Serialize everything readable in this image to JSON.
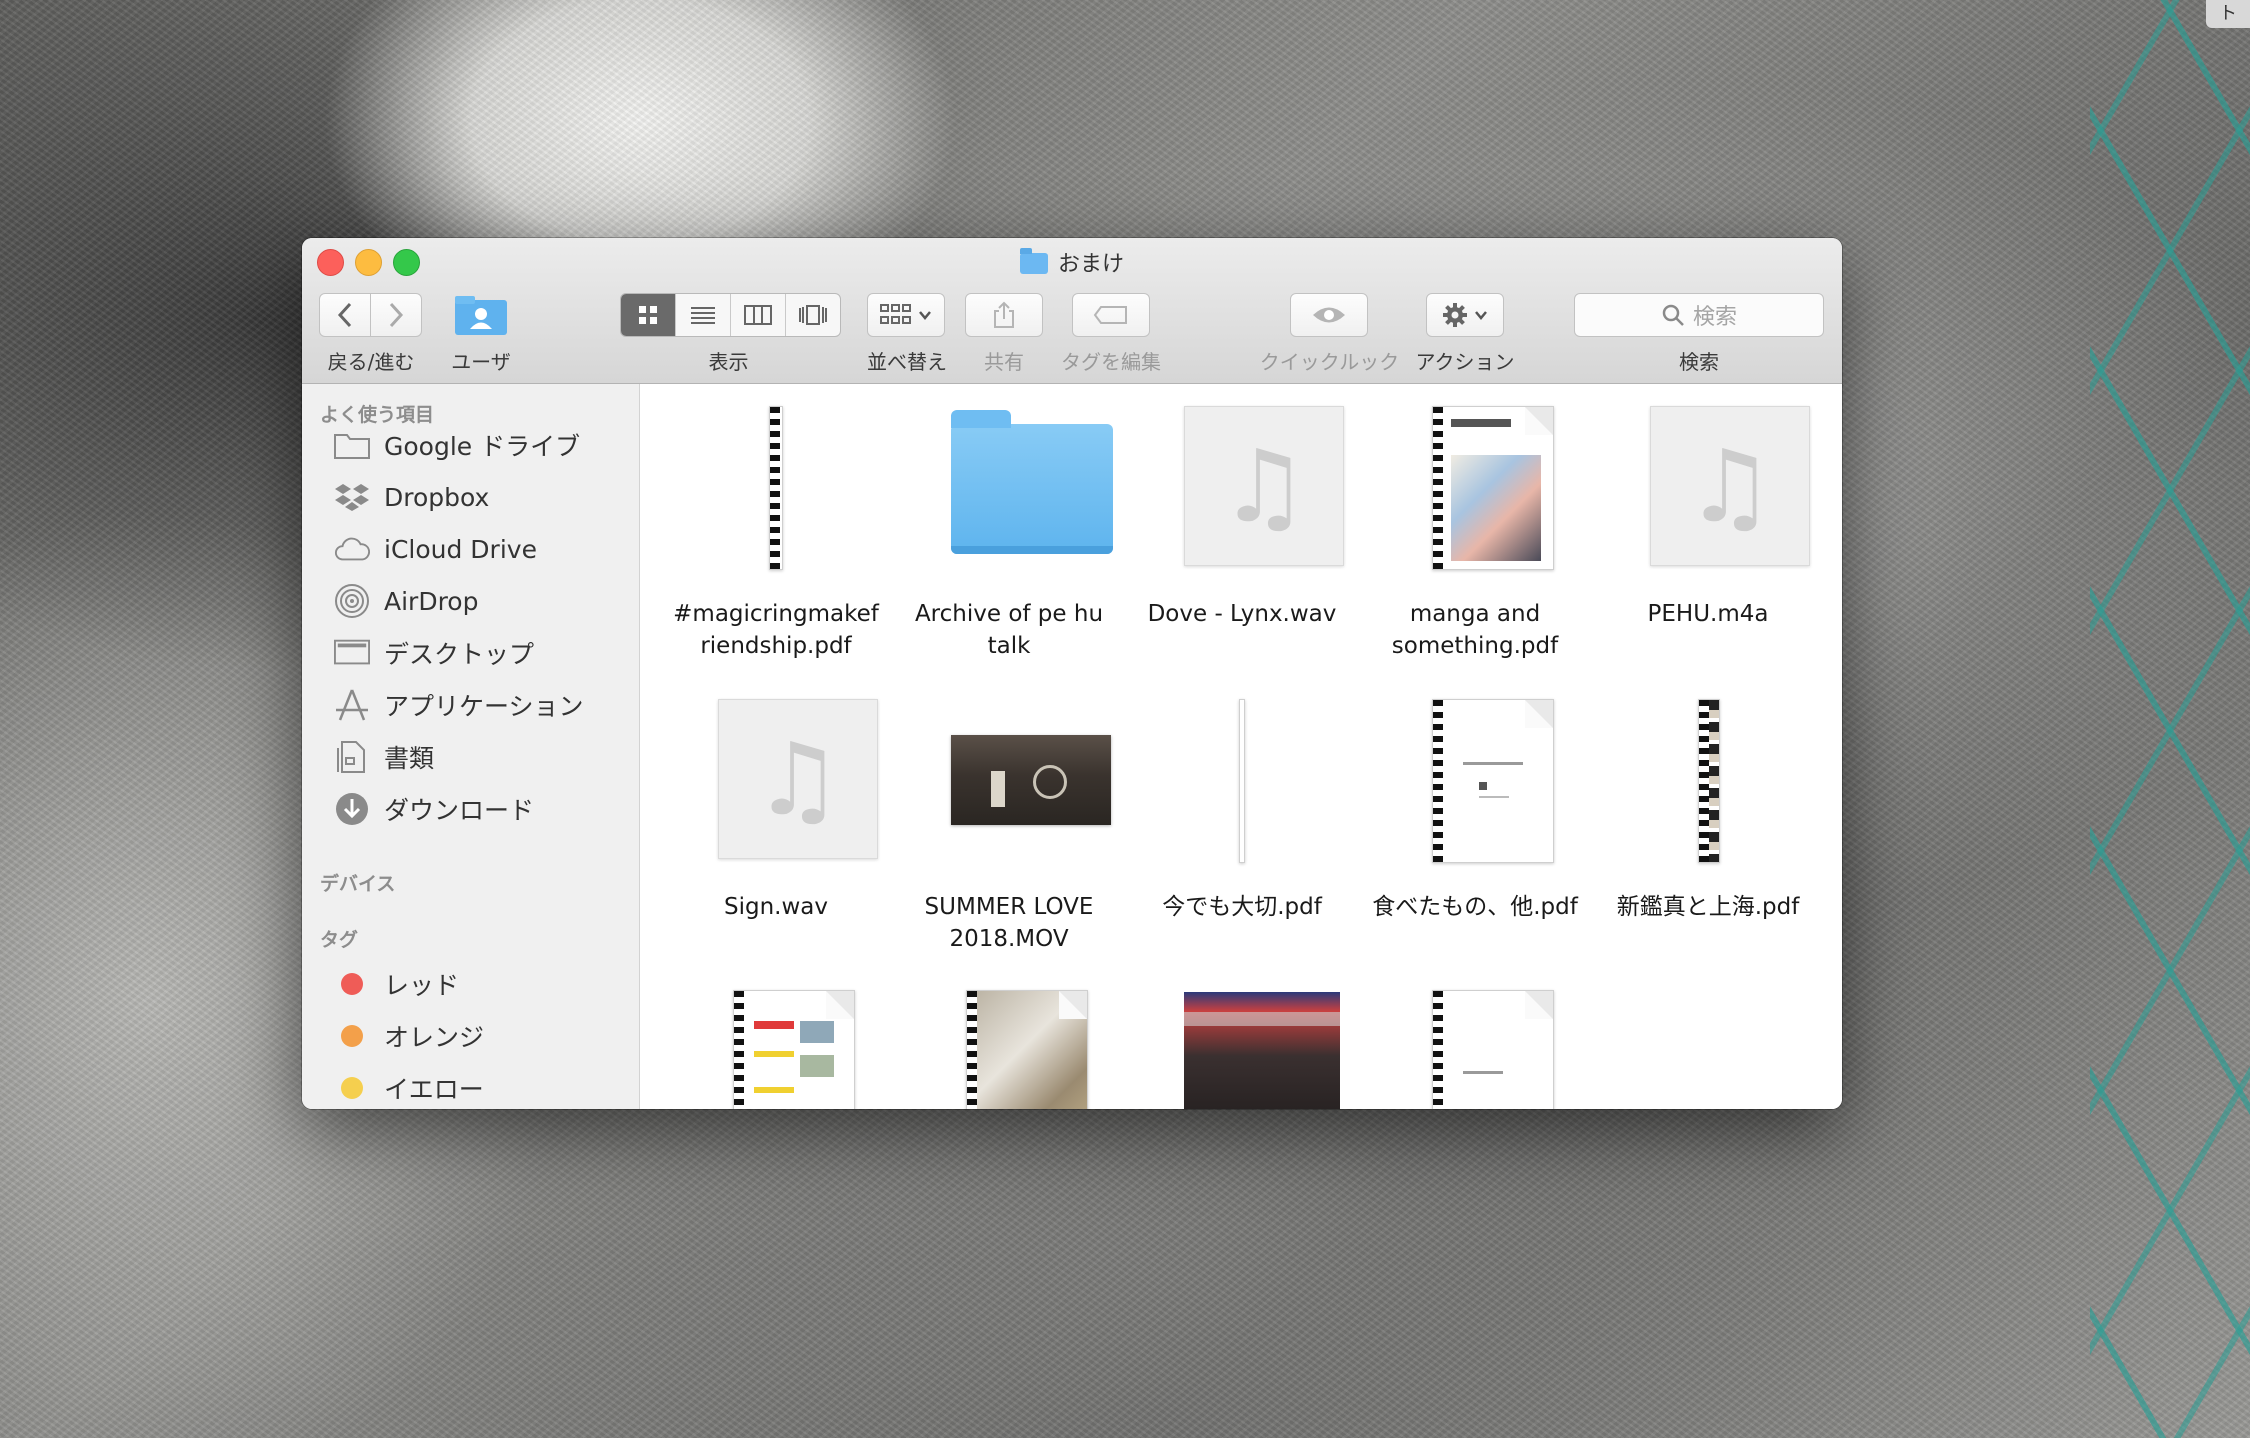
{
  "window": {
    "title": "おまけ"
  },
  "corner": {
    "text": "ト"
  },
  "toolbar": {
    "nav": {
      "back_icon": "chevron-left",
      "forward_icon": "chevron-right",
      "label": "戻る/進む"
    },
    "user": {
      "label": "ユーザ"
    },
    "view": {
      "label": "表示",
      "modes": [
        "icon",
        "list",
        "column",
        "cover-flow"
      ],
      "active": "icon"
    },
    "arrange": {
      "label": "並べ替え"
    },
    "share": {
      "label": "共有"
    },
    "tags": {
      "label": "タグを編集"
    },
    "quicklook": {
      "label": "クイックルック"
    },
    "action": {
      "label": "アクション"
    },
    "search": {
      "placeholder": "検索",
      "label": "検索"
    }
  },
  "sidebar": {
    "favorites_header": "よく使う項目",
    "favorites": [
      {
        "label": "Google ドライブ",
        "icon": "folder-icon"
      },
      {
        "label": "Dropbox",
        "icon": "dropbox-icon"
      },
      {
        "label": "iCloud Drive",
        "icon": "cloud-icon"
      },
      {
        "label": "AirDrop",
        "icon": "airdrop-icon"
      },
      {
        "label": "デスクトップ",
        "icon": "desktop-icon"
      },
      {
        "label": "アプリケーション",
        "icon": "applications-icon"
      },
      {
        "label": "書類",
        "icon": "documents-icon"
      },
      {
        "label": "ダウンロード",
        "icon": "download-icon"
      }
    ],
    "devices_header": "デバイス",
    "tags_header": "タグ",
    "tags": [
      {
        "label": "レッド",
        "color": "#ef5c57"
      },
      {
        "label": "オレンジ",
        "color": "#f3a04a"
      },
      {
        "label": "イエロー",
        "color": "#f5cf4e"
      }
    ]
  },
  "files": [
    {
      "name": "#magicringmakef riendship.pdf",
      "kind": "pdf-strip"
    },
    {
      "name": "Archive of pe hu talk",
      "kind": "folder"
    },
    {
      "name": "Dove - Lynx.wav",
      "kind": "audio"
    },
    {
      "name": "manga and something.pdf",
      "kind": "pdf-cover"
    },
    {
      "name": "PEHU.m4a",
      "kind": "audio"
    },
    {
      "name": "Sign.wav",
      "kind": "audio"
    },
    {
      "name": "SUMMER LOVE 2018.MOV",
      "kind": "video"
    },
    {
      "name": "今でも大切.pdf",
      "kind": "pdf-thin"
    },
    {
      "name": "食べたもの、他.pdf",
      "kind": "pdf-doc"
    },
    {
      "name": "新鑑真と上海.pdf",
      "kind": "pdf-strip"
    },
    {
      "name": "",
      "kind": "pdf-doc"
    },
    {
      "name": "",
      "kind": "pdf-photo"
    },
    {
      "name": "",
      "kind": "image"
    },
    {
      "name": "",
      "kind": "pdf-doc"
    }
  ],
  "colors": {
    "close": "#fc605b",
    "minimize": "#fdbc40",
    "maximize": "#34c84a",
    "folder": "#6cb8f2"
  }
}
